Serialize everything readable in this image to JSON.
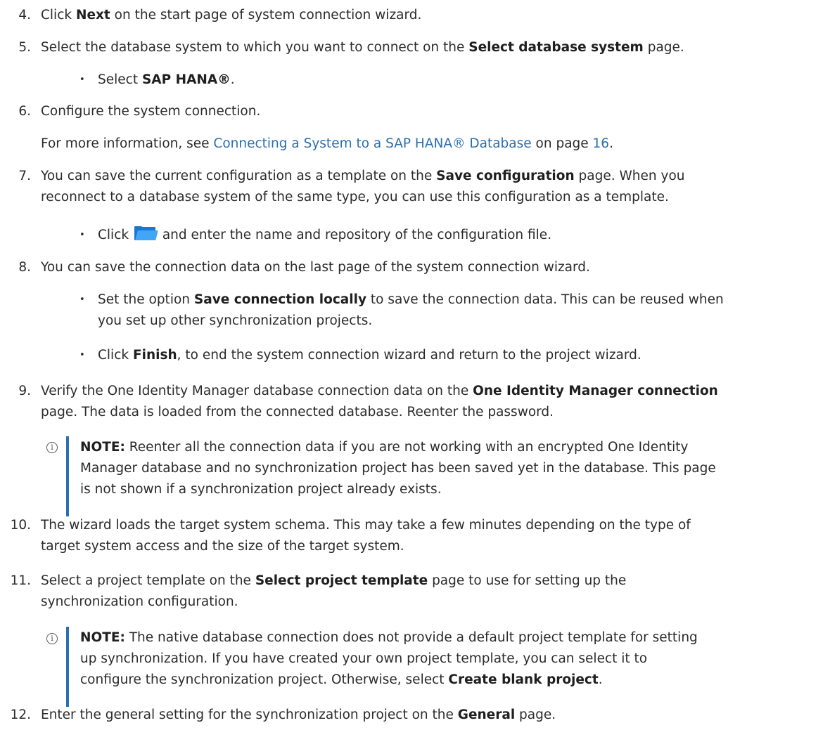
{
  "steps": {
    "s4": {
      "num": "4.",
      "a": "Click ",
      "b": "Next",
      "c": " on the start page of system connection wizard."
    },
    "s5": {
      "num": "5.",
      "a": "Select the database system to which you want to connect on the ",
      "b": "Select database system",
      "c": " page."
    },
    "s5_bullet": {
      "a": "Select ",
      "b": "SAP HANA®",
      "c": "."
    },
    "s6": {
      "num": "6.",
      "text": "Configure the system connection."
    },
    "s6_more": {
      "a": "For more information, see ",
      "link": "Connecting a System to a SAP HANA® Database",
      "b": " on page ",
      "page": "16",
      "c": "."
    },
    "s7": {
      "num": "7.",
      "l1a": "You can save the current configuration as a template on the ",
      "l1b": "Save configuration",
      "l1c": " page. When you",
      "l2": "reconnect to a database system of the same type, you can use this configuration as a template."
    },
    "s7_bullet": {
      "a": "Click ",
      "b": " and enter the name and repository of the configuration file."
    },
    "s8": {
      "num": "8.",
      "text": "You can save the connection data on the last page of the system connection wizard."
    },
    "s8_b1": {
      "a": "Set the option ",
      "b": "Save connection locally",
      "c": " to save the connection data. This can be reused when",
      "l2": "you set up other synchronization projects."
    },
    "s8_b2": {
      "a": "Click ",
      "b": "Finish",
      "c": ", to end the system connection wizard and return to the project wizard."
    },
    "s9": {
      "num": "9.",
      "l1a": "Verify the One Identity Manager database connection data on the ",
      "l1b": "One Identity Manager connection",
      "l2": "page. The data is loaded from the connected database. Reenter the password."
    },
    "note1": {
      "label": "NOTE:",
      "l1": " Reenter all the connection data if you are not working with an encrypted One Identity",
      "l2": "Manager database and no synchronization project has been saved yet in the database. This page",
      "l3": "is not shown if a synchronization project already exists."
    },
    "s10": {
      "num": "10.",
      "l1": "The wizard loads the target system schema. This may take a few minutes depending on the type of",
      "l2": "target system access and the size of the target system."
    },
    "s11": {
      "num": "11.",
      "l1a": "Select a project template on the ",
      "l1b": "Select project template",
      "l1c": " page to use for setting up the",
      "l2": "synchronization configuration."
    },
    "note2": {
      "label": "NOTE:",
      "l1": " The native database connection does not provide a default project template for setting",
      "l2": "up synchronization. If you have created your own project template, you can select it to",
      "l3a": "configure the synchronization project. Otherwise, select ",
      "l3b": "Create blank project",
      "l3c": "."
    },
    "s12": {
      "num": "12.",
      "a": "Enter the general setting for the synchronization project on the ",
      "b": "General",
      "c": " page."
    }
  },
  "icons": {
    "note": "info-icon",
    "folder": "folder-open-icon",
    "bullet": "•"
  },
  "colors": {
    "link": "#2a6fb0",
    "note_bar": "#2a6fb0",
    "folder": "#1976d2"
  }
}
